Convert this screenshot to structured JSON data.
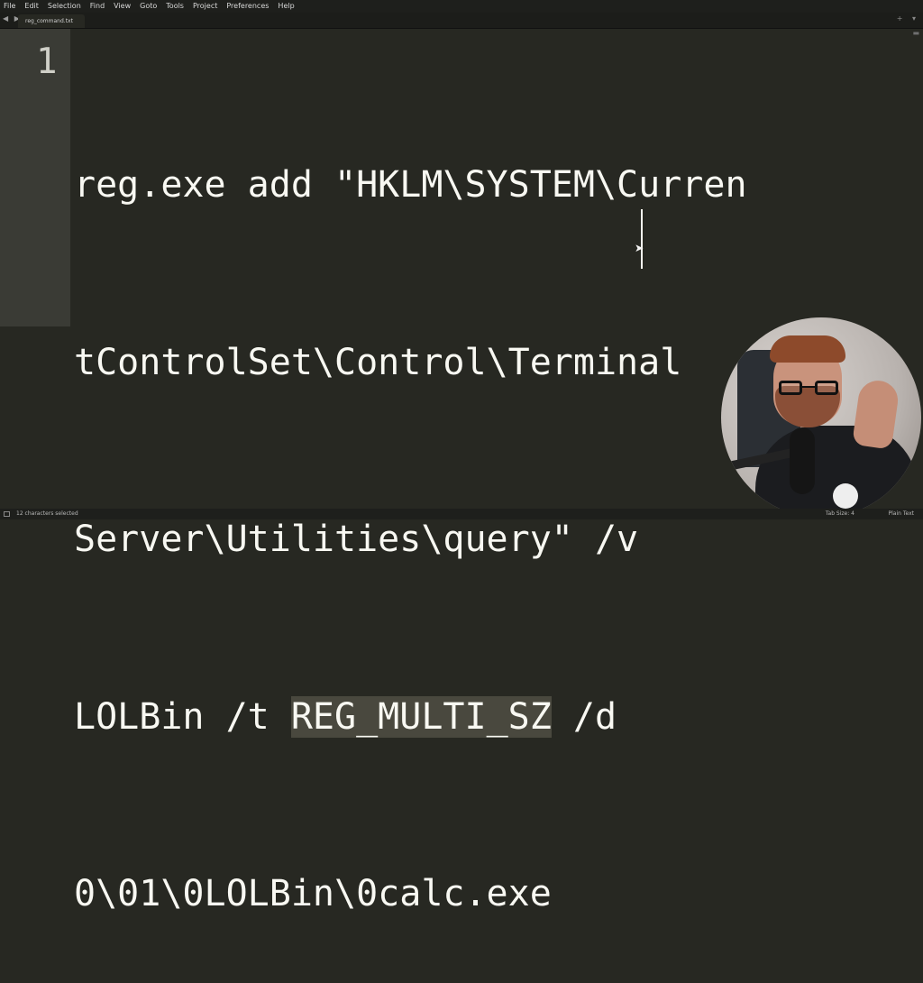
{
  "menubar": {
    "items": [
      "File",
      "Edit",
      "Selection",
      "Find",
      "View",
      "Goto",
      "Tools",
      "Project",
      "Preferences",
      "Help"
    ]
  },
  "tabbar": {
    "nav_icon": "◀ ▶",
    "tab_label": "reg_command.txt",
    "right_controls": "+ ▾"
  },
  "editor": {
    "line_number": "1",
    "code_lines": [
      "reg.exe add \"HKLM\\SYSTEM\\Curren",
      "tControlSet\\Control\\Terminal",
      "Server\\Utilities\\query\" /v",
      "LOLBin /t ",
      "0\\01\\0LOLBin\\0calc.exe"
    ],
    "selected_text": "REG_MULTI_SZ",
    "after_selection": " /d"
  },
  "statusbar": {
    "left_text": "12 characters selected",
    "tab_size": "Tab Size: 4",
    "syntax": "Plain Text"
  },
  "colors": {
    "background": "#272822",
    "gutter": "#3a3b35",
    "selection": "#49483e",
    "text": "#f8f8f2"
  }
}
